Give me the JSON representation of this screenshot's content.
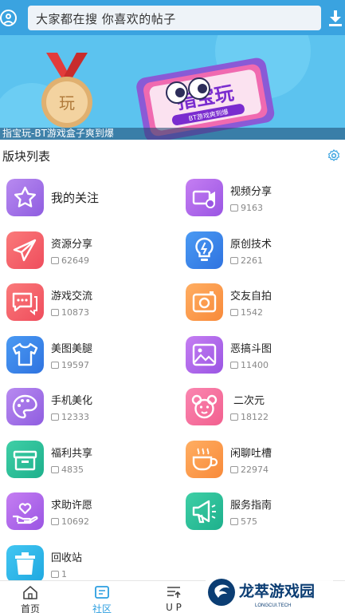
{
  "header": {
    "search_placeholder": "大家都在搜  你喜欢的帖子"
  },
  "banner": {
    "caption": "指宝玩-BT游戏盒子爽到爆",
    "logo_text": "指宝玩",
    "badge_text": "BT游戏爽到爆",
    "medal_text": "玩"
  },
  "section": {
    "title": "版块列表"
  },
  "forums": [
    {
      "name": "我的关注",
      "count": ""
    },
    {
      "name": "视频分享",
      "count": "9163"
    },
    {
      "name": "资源分享",
      "count": "62649"
    },
    {
      "name": "原创技术",
      "count": "2261"
    },
    {
      "name": "游戏交流",
      "count": "10873"
    },
    {
      "name": "交友自拍",
      "count": "1542"
    },
    {
      "name": "美图美腿",
      "count": "19597"
    },
    {
      "name": "恶搞斗图",
      "count": "11400"
    },
    {
      "name": "手机美化",
      "count": "12333"
    },
    {
      "name": "二次元",
      "count": "18122"
    },
    {
      "name": "福利共享",
      "count": "4835"
    },
    {
      "name": "闲聊吐槽",
      "count": "22974"
    },
    {
      "name": "求助许愿",
      "count": "10692"
    },
    {
      "name": "服务指南",
      "count": "575"
    },
    {
      "name": "回收站",
      "count": "1"
    }
  ],
  "nav": {
    "home": "首页",
    "community": "社区",
    "up": "U P"
  },
  "watermark": {
    "title": "龙萃游戏园",
    "subtitle": "LONGCUI.TECH"
  },
  "colors": {
    "header_blue": "#3aa3e0",
    "active_blue": "#2b9ee0"
  }
}
